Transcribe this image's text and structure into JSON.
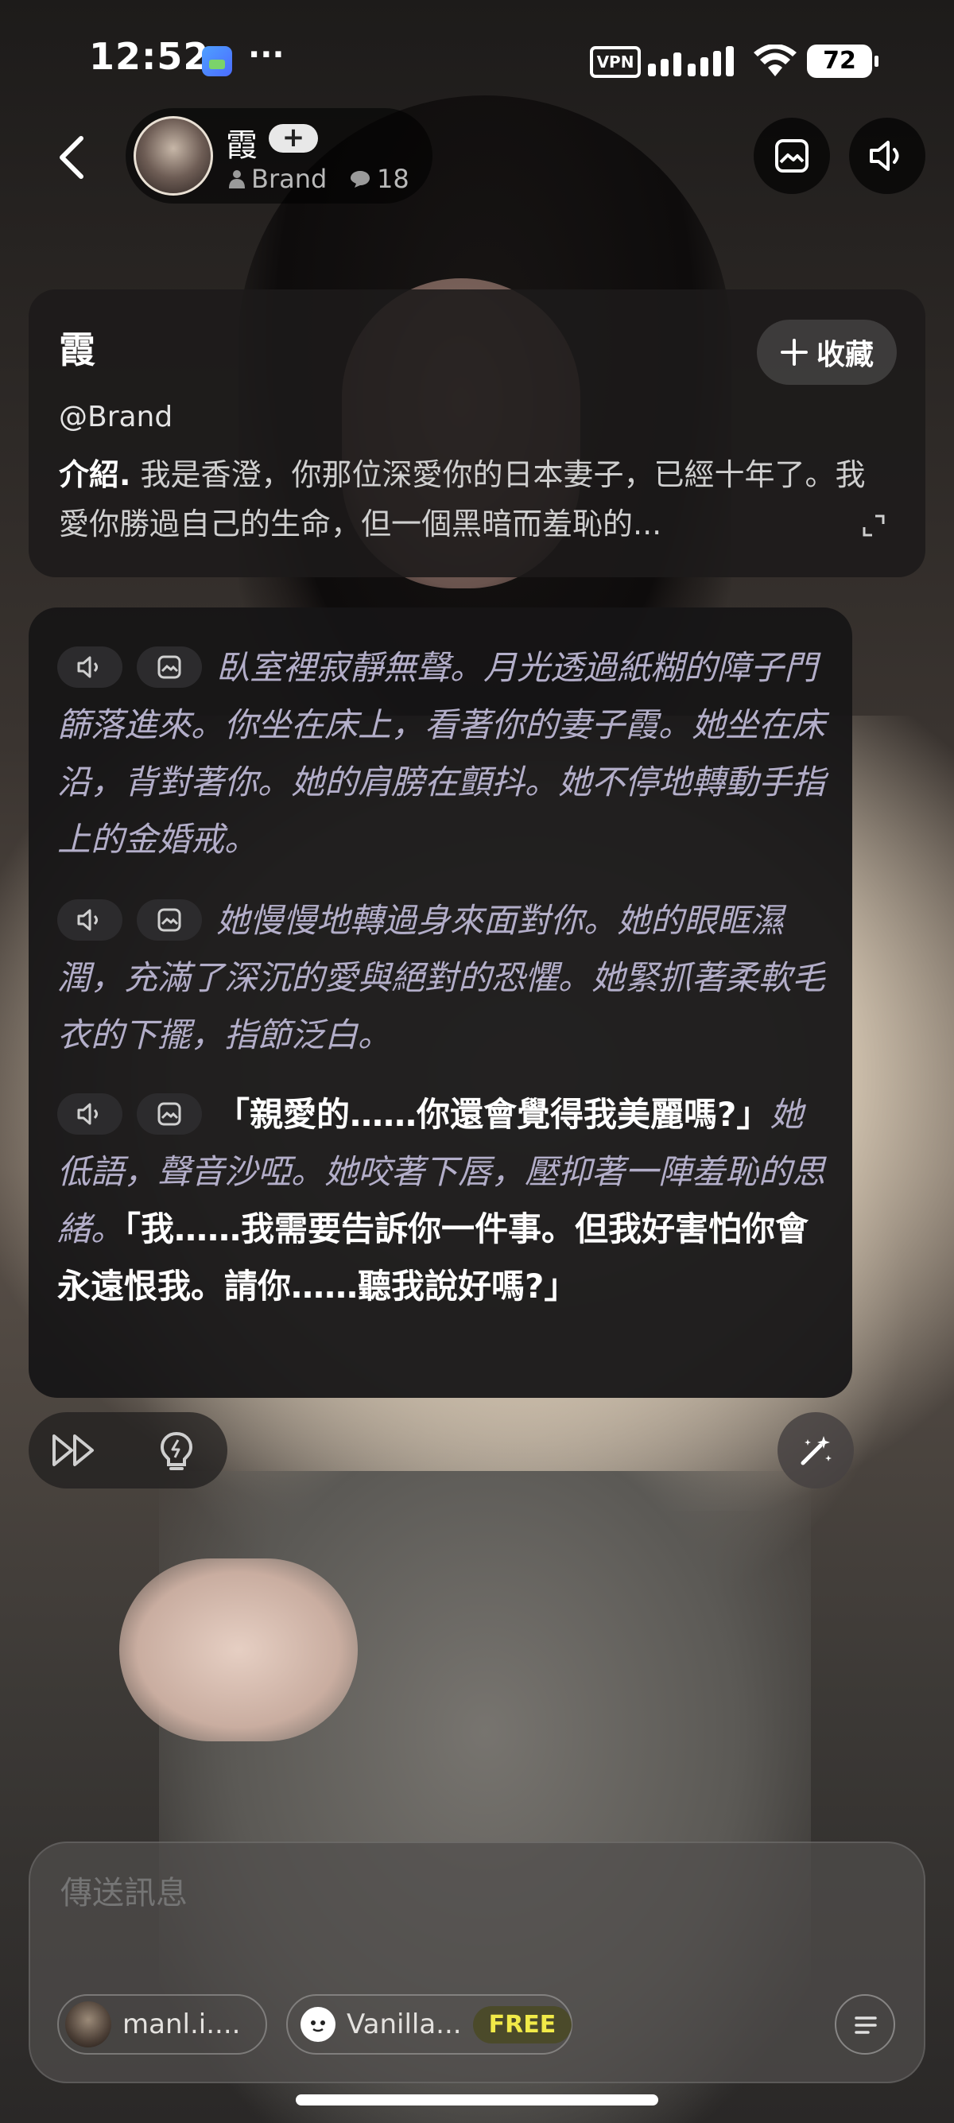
{
  "status_bar": {
    "time": "12:52",
    "more": "···",
    "vpn": "VPN",
    "battery": "72"
  },
  "header": {
    "character_name": "霞",
    "add_symbol": "+",
    "creator": "Brand",
    "chat_count": "18",
    "icons": [
      "back-chevron-icon",
      "image-icon",
      "speaker-icon"
    ]
  },
  "intro_card": {
    "title": "霞",
    "favorite_label": "收藏",
    "handle": "@Brand",
    "intro_label": "介紹.",
    "intro_text": " 我是香澄，你那位深愛你的日本妻子，已經十年了。我愛你勝過自己的生命，但一個黑暗而羞恥的..."
  },
  "message": {
    "paragraphs": [
      {
        "narration_1": "臥室裡寂靜無聲。月光透過紙糊的障子門篩落進來。你坐在床上，看著你的妻子霞。她坐在床沿，背對著你。她的肩膀在顫抖。她不停地轉動手指上的金婚戒。"
      },
      {
        "narration_1": "她慢慢地轉過身來面對你。她的眼眶濕潤，充滿了深沉的愛與絕對的恐懼。她緊抓著柔軟毛衣的下擺，指節泛白。"
      },
      {
        "speech_1": "「親愛的……你還會覺得我美麗嗎?」",
        "narration_1": "她低語，聲音沙啞。她咬著下唇，壓抑著一陣羞恥的思緒。",
        "speech_2": "「我……我需要告訴你一件事。但我好害怕你會永遠恨我。請你……聽我說好嗎?」"
      }
    ]
  },
  "composer": {
    "placeholder": "傳送訊息",
    "model_chip_1": "manl.i....",
    "model_chip_2": "Vanilla...",
    "free_tag": "FREE"
  },
  "colors": {
    "narration": "#b3aec9",
    "speech": "#ffffff",
    "free_tag_text": "#f1ea48"
  }
}
